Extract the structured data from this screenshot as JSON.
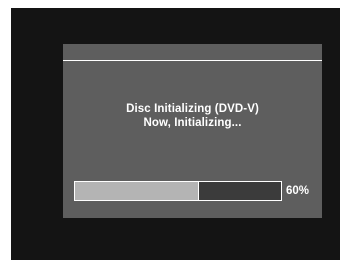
{
  "dialog": {
    "title_line": "Disc Initializing (DVD-V)",
    "status_line": "Now, Initializing..."
  },
  "progress": {
    "fraction": 0.6,
    "label": "60%"
  },
  "colors": {
    "screen_background": "#141414",
    "dialog_background": "#5e5e5e",
    "progress_fill": "#b4b4b4",
    "progress_track": "#3b3b3b",
    "text": "#ffffff"
  }
}
